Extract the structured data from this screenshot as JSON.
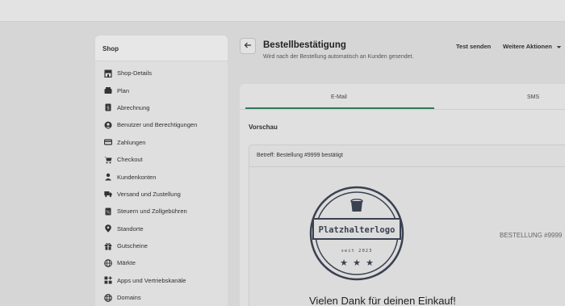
{
  "sidebar": {
    "title": "Shop",
    "items": [
      {
        "label": "Shop-Details",
        "icon": "store-icon"
      },
      {
        "label": "Plan",
        "icon": "plan-icon"
      },
      {
        "label": "Abrechnung",
        "icon": "billing-icon"
      },
      {
        "label": "Benutzer und Berechtigungen",
        "icon": "user-circle-icon"
      },
      {
        "label": "Zahlungen",
        "icon": "payment-icon"
      },
      {
        "label": "Checkout",
        "icon": "cart-icon"
      },
      {
        "label": "Kundenkonten",
        "icon": "person-icon"
      },
      {
        "label": "Versand und Zustellung",
        "icon": "truck-icon"
      },
      {
        "label": "Steuern und Zollgebühren",
        "icon": "tax-icon"
      },
      {
        "label": "Standorte",
        "icon": "location-pin-icon"
      },
      {
        "label": "Gutscheine",
        "icon": "gift-icon"
      },
      {
        "label": "Märkte",
        "icon": "globe-icon"
      },
      {
        "label": "Apps und Vertriebskanäle",
        "icon": "apps-icon"
      },
      {
        "label": "Domains",
        "icon": "domain-globe-icon"
      }
    ]
  },
  "header": {
    "title": "Bestellbestätigung",
    "subtitle": "Wird nach der Bestellung automatisch an Kunden gesendet.",
    "test_send": "Test senden",
    "more_actions": "Weitere Aktionen"
  },
  "tabs": [
    {
      "label": "E-Mail",
      "active": true
    },
    {
      "label": "SMS",
      "active": false
    }
  ],
  "preview": {
    "label": "Vorschau",
    "subject": "Betreff: Bestellung #9999 bestätigt",
    "logo_text": "Platzhalterlogo",
    "logo_since": "seit 2023",
    "order_number": "BESTELLUNG #9999",
    "thanks": "Vielen Dank für deinen Einkauf!"
  },
  "colors": {
    "accent": "#2f7a5a",
    "background": "#d6d6d6"
  }
}
